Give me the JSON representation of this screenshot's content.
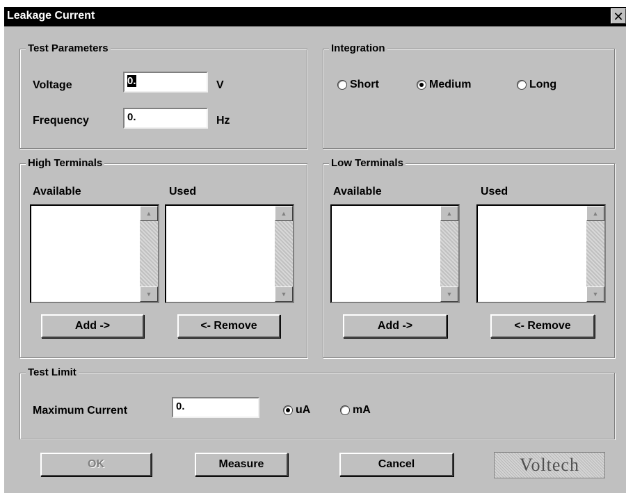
{
  "window": {
    "title": "Leakage Current",
    "close_glyph": "✕"
  },
  "test_parameters": {
    "label": "Test Parameters",
    "voltage_label": "Voltage",
    "voltage_value": "0.",
    "voltage_unit": "V",
    "frequency_label": "Frequency",
    "frequency_value": "0.",
    "frequency_unit": "Hz"
  },
  "integration": {
    "label": "Integration",
    "options": [
      "Short",
      "Medium",
      "Long"
    ],
    "selected": "Medium"
  },
  "high_terminals": {
    "label": "High Terminals",
    "available_label": "Available",
    "used_label": "Used",
    "add_label": "Add ->",
    "remove_label": "<- Remove"
  },
  "low_terminals": {
    "label": "Low Terminals",
    "available_label": "Available",
    "used_label": "Used",
    "add_label": "Add ->",
    "remove_label": "<- Remove"
  },
  "test_limit": {
    "label": "Test Limit",
    "max_current_label": "Maximum Current",
    "max_current_value": "0.",
    "units": [
      "uA",
      "mA"
    ],
    "selected_unit": "uA"
  },
  "buttons": {
    "ok": "OK",
    "measure": "Measure",
    "cancel": "Cancel"
  },
  "logo": {
    "text": "Voltech"
  },
  "icons": {
    "scroll_up": "triangle-up-icon",
    "scroll_down": "triangle-down-icon",
    "close": "close-icon"
  }
}
